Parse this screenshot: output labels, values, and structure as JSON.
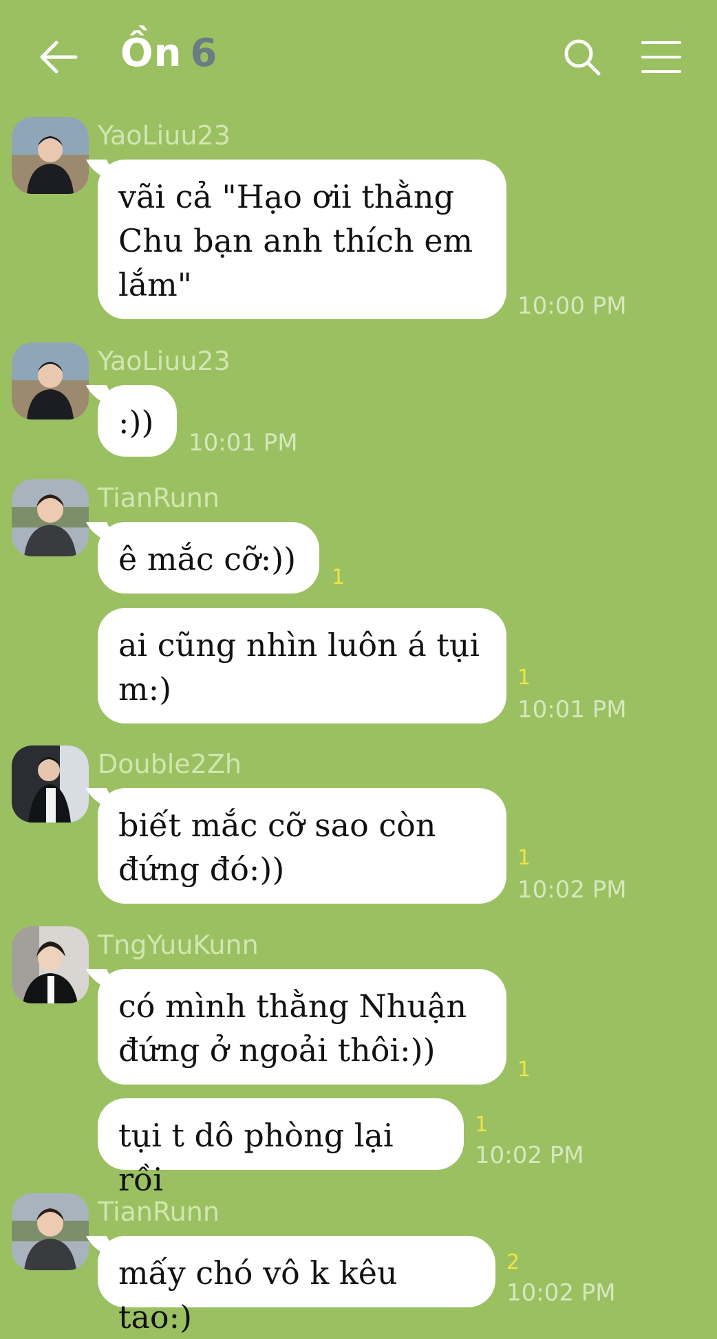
{
  "header": {
    "title": "Ồn",
    "member_count": "6",
    "back_icon": "arrow-left-icon",
    "search_icon": "search-icon",
    "menu_icon": "hamburger-menu-icon"
  },
  "messages": [
    {
      "sender": "YaoLiuu23",
      "text": "vãi cả \"Hạo ơii thằng Chu bạn anh thích em lắm\"",
      "time": "10:00 PM",
      "read": ""
    },
    {
      "sender": "YaoLiuu23",
      "text": ":))",
      "time": "10:01 PM",
      "read": ""
    },
    {
      "sender": "TianRunn",
      "text": "ê mắc cỡ:))",
      "time": "",
      "read": "1"
    },
    {
      "sender": "",
      "text": "ai cũng nhìn luôn á tụi m:)",
      "time": "10:01 PM",
      "read": "1"
    },
    {
      "sender": "Double2Zh",
      "text": "biết mắc cỡ sao còn đứng đó:))",
      "time": "10:02 PM",
      "read": "1"
    },
    {
      "sender": "TngYuuKunn",
      "text": "có mình thằng Nhuận đứng ở ngoải thôi:))",
      "time": "",
      "read": "1"
    },
    {
      "sender": "",
      "text": "tụi t dô phòng lại rồi",
      "time": "10:02 PM",
      "read": "1"
    },
    {
      "sender": "TianRunn",
      "text": "mấy chó vô k kêu tao:)",
      "time": "10:02 PM",
      "read": "2"
    }
  ]
}
